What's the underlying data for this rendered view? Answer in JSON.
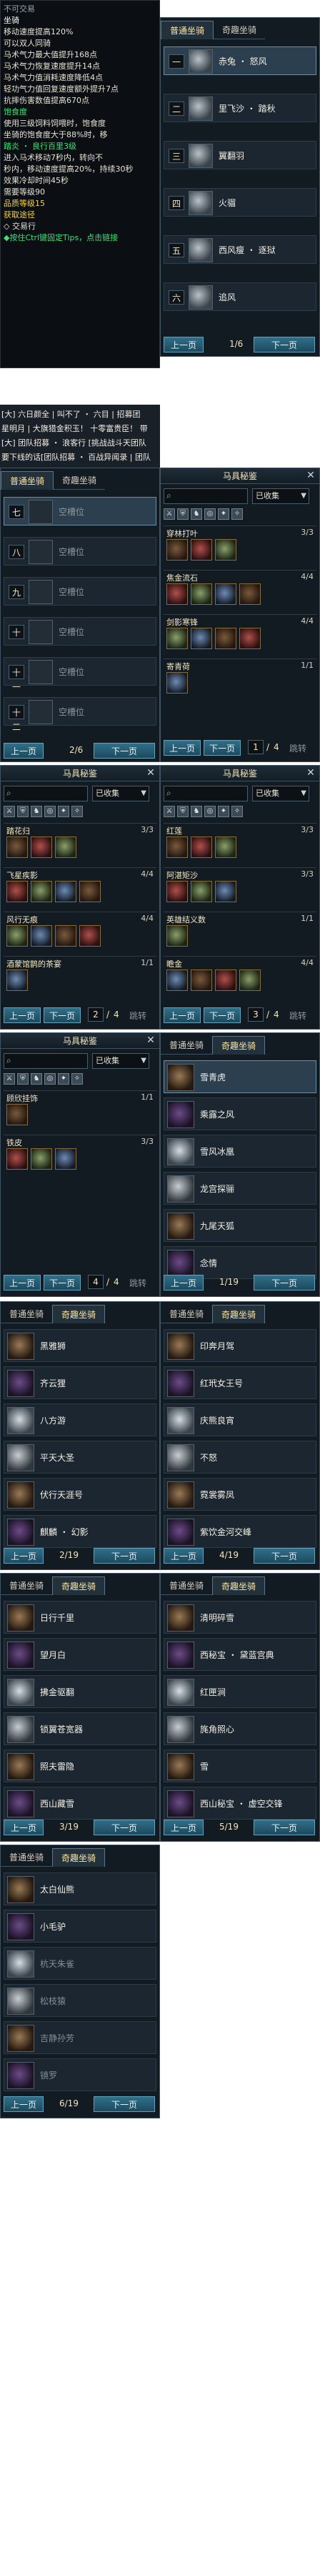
{
  "tooltip": {
    "lines": [
      {
        "text": "不可交易",
        "cls": "gray"
      },
      {
        "text": "坐骑",
        "cls": "white"
      },
      {
        "text": "移动速度提高120%",
        "cls": ""
      },
      {
        "text": "可以双人同骑",
        "cls": ""
      },
      {
        "text": "马术气力最大值提升168点",
        "cls": ""
      },
      {
        "text": "马术气力恢复速度提升14点",
        "cls": ""
      },
      {
        "text": "马术气力值消耗速度降低4点",
        "cls": ""
      },
      {
        "text": "轻功气力值回复速度额外提升7点",
        "cls": ""
      },
      {
        "text": "抗摔伤害数值提高670点",
        "cls": ""
      },
      {
        "text": "饱食度",
        "cls": "green"
      },
      {
        "text": "使用三级饲料饲喂时，饱食度",
        "cls": ""
      },
      {
        "text": "坐骑的饱食度大于88%时，移",
        "cls": ""
      },
      {
        "text": "踏炎 ・ 良行百里3级",
        "cls": "green"
      },
      {
        "text": "进入马术移动7秒内，转向不",
        "cls": ""
      },
      {
        "text": "秒内，移动速度提高20%，持续30秒",
        "cls": ""
      },
      {
        "text": "效果冷却时间45秒",
        "cls": ""
      },
      {
        "text": "需要等级90",
        "cls": ""
      },
      {
        "text": "品质等级15",
        "cls": "yellow"
      },
      {
        "text": "获取途径",
        "cls": "yellow"
      },
      {
        "text": "◇ 交易行",
        "cls": ""
      },
      {
        "text": "◆按住Ctrl键固定Tips，点击链接",
        "cls": "green"
      }
    ]
  },
  "chat": {
    "lines": [
      "[大] 六日颜全 | 叫不了 ・ 六目 | 招募团",
      "星明月 | 大旗猎金积玉！ 十零富贵臣！ 带",
      "[大] 团队招募 ・ 浪客行 [挑战战斗天团队",
      "要下线的话[团队招募 ・ 百战异闻录 | 团队"
    ]
  },
  "panel_a": {
    "tabs": [
      "普通坐骑",
      "奇趣坐骑"
    ],
    "rows": [
      {
        "num": "一",
        "name": "赤兔 ・ 怒风"
      },
      {
        "num": "二",
        "name": "里飞沙 ・ 踏秋"
      },
      {
        "num": "三",
        "name": "翼翻羽"
      },
      {
        "num": "四",
        "name": "火骝"
      },
      {
        "num": "五",
        "name": "西风瘦 ・ 逐狱"
      },
      {
        "num": "六",
        "name": "追风"
      }
    ],
    "prev": "上一页",
    "next": "下一页",
    "page": "1/6"
  },
  "panel_b": {
    "tabs": [
      "普通坐骑",
      "奇趣坐骑"
    ],
    "rows": [
      {
        "num": "七",
        "name": "空槽位"
      },
      {
        "num": "八",
        "name": "空槽位"
      },
      {
        "num": "九",
        "name": "空槽位"
      },
      {
        "num": "十",
        "name": "空槽位"
      },
      {
        "num": "十一",
        "name": "空槽位"
      },
      {
        "num": "十二",
        "name": "空槽位"
      }
    ],
    "prev": "上一页",
    "next": "下一页",
    "page": "2/6"
  },
  "collection_c": {
    "title": "马具秘鉴",
    "filter": "已收集",
    "groups": [
      {
        "name": "穿林打叶",
        "count": "3/3",
        "slots": 3
      },
      {
        "name": "焦金流石",
        "count": "4/4",
        "slots": 4
      },
      {
        "name": "剑影寒锋",
        "count": "4/4",
        "slots": 4
      },
      {
        "name": "寄青荷",
        "count": "1/1",
        "slots": 1
      }
    ],
    "prev": "上一页",
    "next": "下一页",
    "page": "1",
    "total": "4",
    "jump": "跳转"
  },
  "collection_d": {
    "title": "马具秘鉴",
    "filter": "已收集",
    "groups": [
      {
        "name": "踏花归",
        "count": "3/3",
        "slots": 3
      },
      {
        "name": "飞星疾影",
        "count": "4/4",
        "slots": 4
      },
      {
        "name": "风行无痕",
        "count": "4/4",
        "slots": 4
      },
      {
        "name": "酒蒙馆鹊的茶宴",
        "count": "1/1",
        "slots": 1
      }
    ],
    "prev": "上一页",
    "next": "下一页",
    "page": "2",
    "total": "4",
    "jump": "跳转"
  },
  "collection_e": {
    "title": "马具秘鉴",
    "filter": "已收集",
    "groups": [
      {
        "name": "红莲",
        "count": "3/3",
        "slots": 3
      },
      {
        "name": "阿湛矩沙",
        "count": "3/3",
        "slots": 3
      },
      {
        "name": "英雄结义数",
        "count": "1/1",
        "slots": 1
      },
      {
        "name": "瞻金",
        "count": "4/4",
        "slots": 4
      }
    ],
    "prev": "上一页",
    "next": "下一页",
    "page": "3",
    "total": "4",
    "jump": "跳转"
  },
  "collection_f": {
    "title": "马具秘鉴",
    "filter": "已收集",
    "groups": [
      {
        "name": "顾欣挂饰",
        "count": "1/1",
        "slots": 1
      },
      {
        "name": "铁皮",
        "count": "3/3",
        "slots": 3
      }
    ],
    "prev": "上一页",
    "next": "下一页",
    "page": "4",
    "total": "4",
    "jump": "跳转"
  },
  "fun_g": {
    "tabs": [
      "普通坐骑",
      "奇趣坐骑"
    ],
    "rows": [
      "雪青虎",
      "乘露之风",
      "雪风冰凰",
      "龙宫探骊",
      "九尾天狐",
      "念情"
    ],
    "prev": "上一页",
    "next": "下一页",
    "page": "1/19"
  },
  "fun_h": {
    "tabs": [
      "普通坐骑",
      "奇趣坐骑"
    ],
    "rows": [
      "黑雅狮",
      "齐云狸",
      "八方游",
      "平天大圣",
      "伏行天涯号",
      "麒麟 ・ 幻影"
    ],
    "prev": "上一页",
    "next": "下一页",
    "page": "2/19"
  },
  "fun_i": {
    "tabs": [
      "普通坐骑",
      "奇趣坐骑"
    ],
    "rows": [
      "印奔月驾",
      "红玳女王号",
      "庆熊良宵",
      "不怒",
      "霓裳雾凤",
      "紫饮金河交峰"
    ],
    "prev": "上一页",
    "next": "下一页",
    "page": "4/19"
  },
  "fun_j": {
    "tabs": [
      "普通坐骑",
      "奇趣坐骑"
    ],
    "rows": [
      "日行千里",
      "望月白",
      "拂金驱翻",
      "锁翼苍宽器",
      "照夫雷隐",
      "西山藏雪"
    ],
    "prev": "上一页",
    "next": "下一页",
    "page": "3/19"
  },
  "fun_k": {
    "tabs": [
      "普通坐骑",
      "奇趣坐骑"
    ],
    "rows": [
      "清明碎雪",
      "西秘宝 ・ 黛蓝宫典",
      "红匣涧",
      "旄角照心",
      "雪",
      "西山秘宝 ・ 虚空交锋"
    ],
    "prev": "上一页",
    "next": "下一页",
    "page": "5/19"
  },
  "fun_l": {
    "tabs": [
      "普通坐骑",
      "奇趣坐骑"
    ],
    "rows": [
      "太白仙熊",
      "小毛驴",
      "杭天朱雀",
      "松枝猿",
      "吉静孙芳",
      "镜罗"
    ],
    "prev": "上一页",
    "next": "下一页",
    "page": "6/19"
  }
}
